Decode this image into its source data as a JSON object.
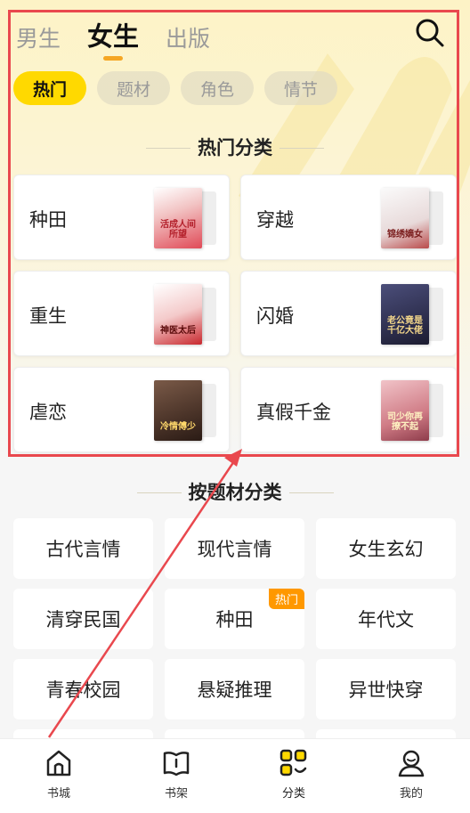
{
  "top_tabs": [
    {
      "label": "男生"
    },
    {
      "label": "女生"
    },
    {
      "label": "出版"
    }
  ],
  "chips": [
    {
      "label": "热门"
    },
    {
      "label": "题材"
    },
    {
      "label": "角色"
    },
    {
      "label": "情节"
    }
  ],
  "hot_section": {
    "title": "热门分类",
    "cards": [
      {
        "label": "种田",
        "cover_title": "活成人间所望",
        "cover_color": "#e04a57"
      },
      {
        "label": "穿越",
        "cover_title": "锦绣嫡女",
        "cover_color": "#f0e6e6"
      },
      {
        "label": "重生",
        "cover_title": "神医太后",
        "cover_color": "#f6d6d6"
      },
      {
        "label": "闪婚",
        "cover_title": "老公竟是千亿大佬",
        "cover_color": "#3c3a5c"
      },
      {
        "label": "虐恋",
        "cover_title": "冷情傅少",
        "cover_color": "#5a3f36"
      },
      {
        "label": "真假千金",
        "cover_title": "司少你再撩不起",
        "cover_color": "#c9747a"
      }
    ]
  },
  "subject_section": {
    "title": "按题材分类",
    "tiles": [
      {
        "label": "古代言情",
        "badge": ""
      },
      {
        "label": "现代言情",
        "badge": ""
      },
      {
        "label": "女生玄幻",
        "badge": ""
      },
      {
        "label": "清穿民国",
        "badge": ""
      },
      {
        "label": "种田",
        "badge": "热门"
      },
      {
        "label": "年代文",
        "badge": ""
      },
      {
        "label": "青春校园",
        "badge": ""
      },
      {
        "label": "悬疑推理",
        "badge": ""
      },
      {
        "label": "异世快穿",
        "badge": ""
      }
    ]
  },
  "bottom_nav": [
    {
      "label": "书城",
      "icon": "home-icon"
    },
    {
      "label": "书架",
      "icon": "book-icon"
    },
    {
      "label": "分类",
      "icon": "category-icon"
    },
    {
      "label": "我的",
      "icon": "profile-icon"
    }
  ],
  "colors": {
    "accent": "#ffd900",
    "tab_underline": "#f5a623",
    "badge": "#ff9800",
    "annotation": "#e9484e"
  }
}
